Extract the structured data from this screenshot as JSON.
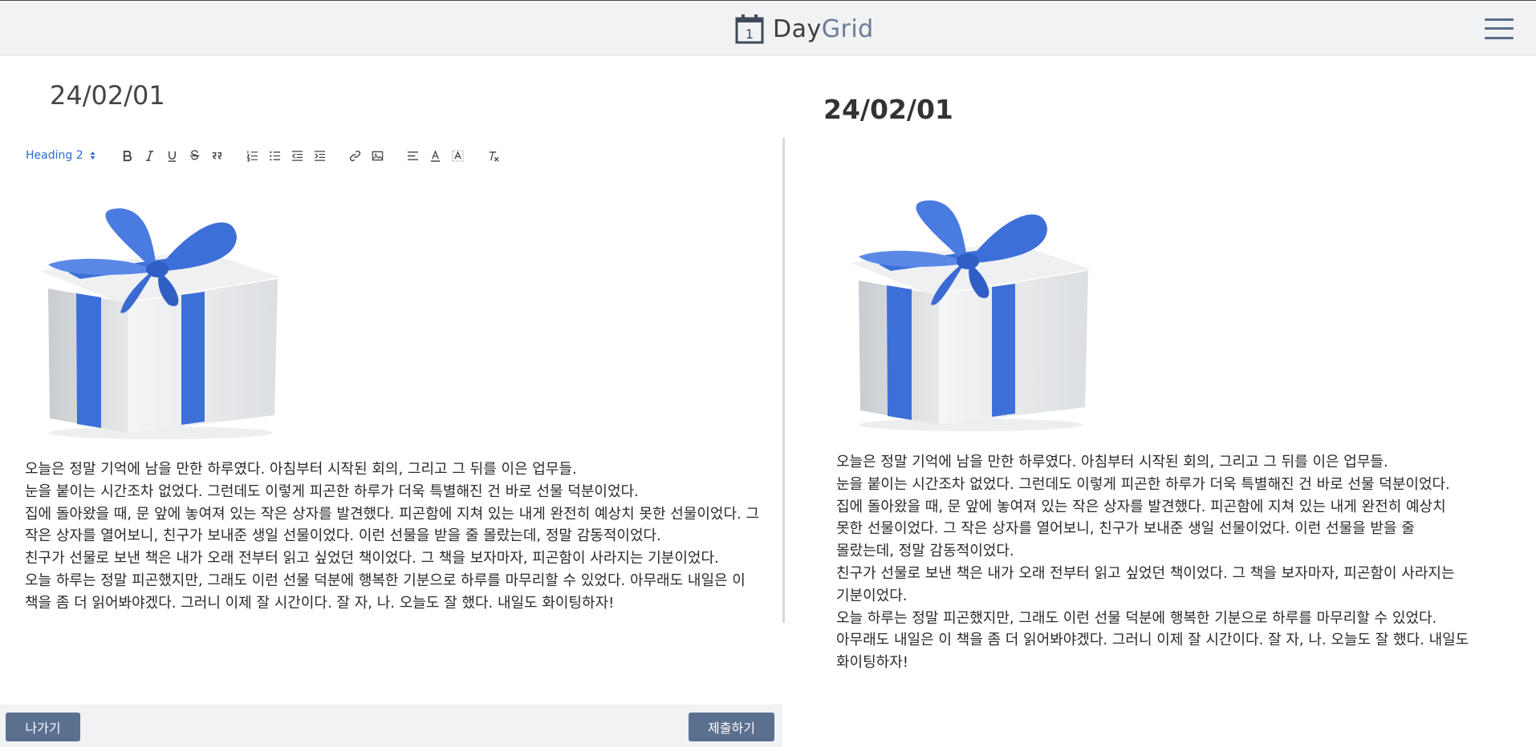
{
  "app": {
    "logo_day": "Day",
    "logo_grid": "Grid",
    "calendar_number": "1"
  },
  "editor": {
    "title": "24/02/01",
    "heading_select": "Heading 2",
    "toolbar_icons": [
      "bold-icon",
      "italic-icon",
      "underline-icon",
      "strikethrough-icon",
      "blockquote-icon",
      "ordered-list-icon",
      "bullet-list-icon",
      "outdent-icon",
      "indent-icon",
      "link-icon",
      "image-icon",
      "align-icon",
      "text-color-icon",
      "background-color-icon",
      "clear-format-icon"
    ],
    "paragraphs": [
      "오늘은 정말 기억에 남을 만한 하루였다. 아침부터 시작된 회의, 그리고 그 뒤를 이은 업무들.",
      "눈을 붙이는 시간조차 없었다. 그런데도 이렇게 피곤한 하루가 더욱 특별해진 건 바로 선물 덕분이었다.",
      "집에 돌아왔을 때, 문 앞에 놓여져 있는 작은 상자를 발견했다. 피곤함에 지쳐 있는 내게 완전히 예상치 못한 선물이었다. 그 작은 상자를 열어보니, 친구가 보내준 생일 선물이었다. 이런 선물을 받을 줄 몰랐는데, 정말 감동적이었다.",
      "친구가 선물로 보낸 책은 내가 오래 전부터 읽고 싶었던 책이었다. 그 책을 보자마자, 피곤함이 사라지는 기분이었다.",
      "오늘 하루는 정말 피곤했지만, 그래도 이런 선물 덕분에 행복한 기분으로 하루를 마무리할 수 있었다. 아무래도 내일은 이 책을 좀 더 읽어봐야겠다. 그러니 이제 잘 시간이다. 잘 자, 나. 오늘도 잘 했다. 내일도 화이팅하자!"
    ]
  },
  "preview": {
    "title": "24/02/01",
    "paragraphs": [
      "오늘은 정말 기억에 남을 만한 하루였다. 아침부터 시작된 회의, 그리고 그 뒤를 이은 업무들.",
      "눈을 붙이는 시간조차 없었다. 그런데도 이렇게 피곤한 하루가 더욱 특별해진 건 바로 선물 덕분이었다.",
      "집에 돌아왔을 때, 문 앞에 놓여져 있는 작은 상자를 발견했다. 피곤함에 지쳐 있는 내게 완전히 예상치 못한 선물이었다. 그 작은 상자를 열어보니, 친구가 보내준 생일 선물이었다. 이런 선물을 받을 줄 몰랐는데, 정말 감동적이었다.",
      "친구가 선물로 보낸 책은 내가 오래 전부터 읽고 싶었던 책이었다. 그 책을 보자마자, 피곤함이 사라지는 기분이었다.",
      "오늘 하루는 정말 피곤했지만, 그래도 이런 선물 덕분에 행복한 기분으로 하루를 마무리할 수 있었다. 아무래도 내일은 이 책을 좀 더 읽어봐야겠다. 그러니 이제 잘 시간이다. 잘 자, 나. 오늘도 잘 했다. 내일도 화이팅하자!"
    ]
  },
  "buttons": {
    "exit": "나가기",
    "submit": "제출하기"
  },
  "colors": {
    "accent": "#5b6f8f",
    "ribbon": "#3d6fd8",
    "topbar": "#f1f2f4",
    "link_blue": "#2a6bd6"
  }
}
